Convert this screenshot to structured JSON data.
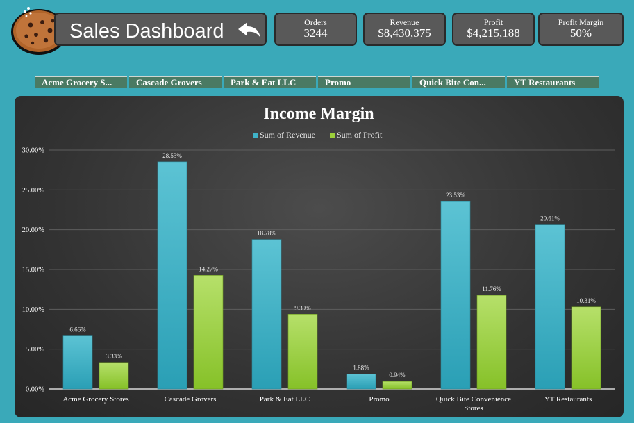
{
  "header": {
    "title": "Sales Dashboard",
    "back_icon": "undo-arrow-icon",
    "logo_icon": "cookie-icon"
  },
  "kpis": [
    {
      "label": "Orders",
      "value": "3244"
    },
    {
      "label": "Revenue",
      "value": "$8,430,375"
    },
    {
      "label": "Profit",
      "value": "$4,215,188"
    },
    {
      "label": "Profit Margin",
      "value": "50%"
    }
  ],
  "slicers": [
    "Acme Grocery S...",
    "Cascade Grovers",
    "Park & Eat LLC",
    "Promo",
    "Quick Bite Con...",
    "YT Restaurants"
  ],
  "colors": {
    "background": "#3aa9b9",
    "revenue": "#3fb3c8",
    "profit": "#9ccf3a"
  },
  "chart_data": {
    "type": "bar",
    "title": "Income Margin",
    "categories": [
      "Acme Grocery Stores",
      "Cascade Grovers",
      "Park & Eat LLC",
      "Promo",
      "Quick Bite Convenience Stores",
      "YT Restaurants"
    ],
    "series": [
      {
        "name": "Sum of Revenue",
        "values": [
          6.66,
          28.53,
          18.78,
          1.88,
          23.53,
          20.61
        ],
        "labels": [
          "6.66%",
          "28.53%",
          "18.78%",
          "1.88%",
          "23.53%",
          "20.61%"
        ]
      },
      {
        "name": "Sum of Profit",
        "values": [
          3.33,
          14.27,
          9.39,
          0.94,
          11.76,
          10.31
        ],
        "labels": [
          "3.33%",
          "14.27%",
          "9.39%",
          "0.94%",
          "11.76%",
          "10.31%"
        ]
      }
    ],
    "yticks": [
      "0.00%",
      "5.00%",
      "10.00%",
      "15.00%",
      "20.00%",
      "25.00%",
      "30.00%"
    ],
    "ylim": [
      0,
      30
    ],
    "grid": true,
    "legend": "top"
  }
}
